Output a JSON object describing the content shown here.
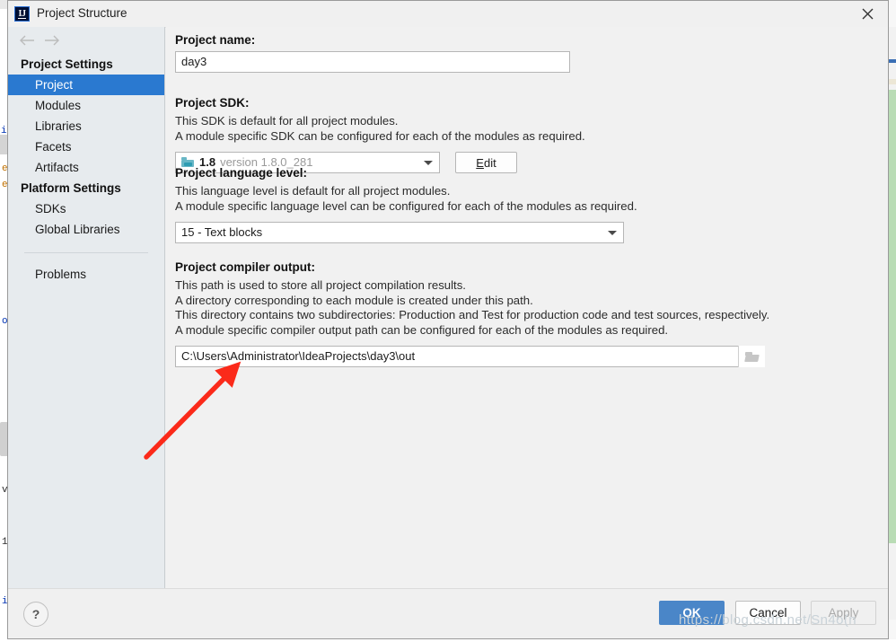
{
  "window": {
    "title": "Project Structure",
    "app_icon": "intellij-idea-icon",
    "close_label": "close-icon"
  },
  "nav": {
    "back": "back-arrow-icon",
    "forward": "forward-arrow-icon"
  },
  "sidebar": {
    "groups": [
      {
        "label": "Project Settings",
        "items": [
          {
            "label": "Project",
            "selected": true
          },
          {
            "label": "Modules",
            "selected": false
          },
          {
            "label": "Libraries",
            "selected": false
          },
          {
            "label": "Facets",
            "selected": false
          },
          {
            "label": "Artifacts",
            "selected": false
          }
        ]
      },
      {
        "label": "Platform Settings",
        "items": [
          {
            "label": "SDKs",
            "selected": false
          },
          {
            "label": "Global Libraries",
            "selected": false
          }
        ]
      }
    ],
    "extra": [
      {
        "label": "Problems",
        "selected": false
      }
    ]
  },
  "main": {
    "project_name": {
      "title": "Project name:",
      "value": "day3"
    },
    "project_sdk": {
      "title": "Project SDK:",
      "desc_line1": "This SDK is default for all project modules.",
      "desc_line2": "A module specific SDK can be configured for each of the modules as required.",
      "sdk_icon": "sdk-folder-icon",
      "sdk_name": "1.8",
      "sdk_version": "version 1.8.0_281",
      "edit_label_pre": "E",
      "edit_label_post": "dit"
    },
    "language_level": {
      "title": "Project language level:",
      "desc_line1": "This language level is default for all project modules.",
      "desc_line2": "A module specific language level can be configured for each of the modules as required.",
      "value": "15 - Text blocks"
    },
    "compiler_output": {
      "title": "Project compiler output:",
      "desc_line1": "This path is used to store all project compilation results.",
      "desc_line2": "A directory corresponding to each module is created under this path.",
      "desc_line3": "This directory contains two subdirectories: Production and Test for production code and test sources, respectively.",
      "desc_line4": "A module specific compiler output path can be configured for each of the modules as required.",
      "value": "C:\\Users\\Administrator\\IdeaProjects\\day3\\out",
      "browse_icon": "folder-browse-icon"
    }
  },
  "footer": {
    "help_label": "?",
    "ok_label": "OK",
    "cancel_label": "Cancel",
    "apply_label": "Apply"
  },
  "annotation": {
    "arrow_color": "#fb2a1a",
    "arrow_name": "red-pointer-arrow",
    "watermark": "https://blog.csdn.net/Sn4o(n"
  },
  "background_ide": {
    "code_fragments": [
      "ir",
      "e",
      "e",
      "o",
      "v",
      "1",
      "i"
    ]
  },
  "colors": {
    "accent": "#2a79d0",
    "ok_button": "#4a86c8",
    "sidebar_bg": "#e7ebee",
    "dialog_bg": "#f0f0f0"
  }
}
